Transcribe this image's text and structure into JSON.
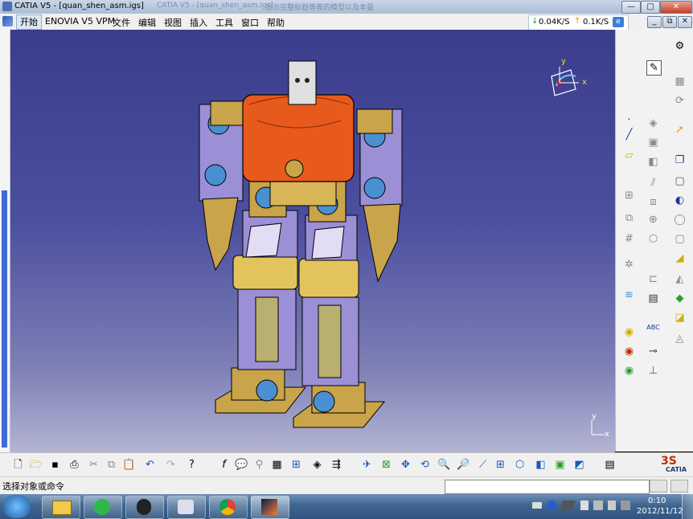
{
  "window": {
    "title": "CATIA V5 - [quan_shen_asm.igs]",
    "faded_title_1": "CATIA V5 - [quan_shen_asm.igs]",
    "faded_title_2": "显示完整标题等等的模型以及本量",
    "buttons": [
      "—",
      "□",
      "✕"
    ],
    "mdi_buttons": [
      "_",
      "⧉",
      "✕"
    ]
  },
  "menubar": {
    "items": [
      "开始",
      "ENOVIA V5 VPM",
      "文件",
      "编辑",
      "视图",
      "插入",
      "工具",
      "窗口",
      "帮助"
    ]
  },
  "network": {
    "down": "0.04K/S",
    "up": "0.1K/S"
  },
  "compass": {
    "x_label": "x",
    "y_label": "y"
  },
  "corner_axis": {
    "x_label": "x",
    "y_label": "y"
  },
  "statusbar": {
    "prompt": "选择对象或命令",
    "command_value": ""
  },
  "brand": {
    "logo_text": "CATIA"
  },
  "taskbar": {
    "time": "0:10",
    "date": "2012/11/12"
  },
  "icons": {
    "right_toolbar": [
      "gear-icon",
      "sketch-icon",
      "measure-icon",
      "arrow-select-icon",
      "point-icon",
      "line-icon",
      "plane-icon",
      "axis-icon",
      "product-icon",
      "component-icon",
      "new-part-icon",
      "existing-component-icon",
      "replace-icon",
      "manipulate-icon",
      "snap-icon",
      "explode-icon",
      "constraint-icon",
      "offset-icon",
      "angle-icon",
      "fix-icon",
      "update-icon",
      "catalog-icon",
      "scene-icon",
      "annotation-icon",
      "text-icon",
      "flag-icon",
      "weld-icon",
      "clash-icon",
      "section-icon",
      "distance-icon"
    ],
    "bottom_toolbar": [
      "new-icon",
      "open-icon",
      "save-icon",
      "print-icon",
      "cut-icon",
      "copy-icon",
      "paste-icon",
      "undo-icon",
      "redo-icon",
      "whats-this-icon",
      "formula-icon",
      "comment-icon",
      "tools-icon",
      "grid-icon",
      "tree-icon",
      "hide-icon",
      "swap-icon",
      "fly-icon",
      "fit-all-icon",
      "pan-icon",
      "rotate-icon",
      "zoom-in-icon",
      "zoom-out-icon",
      "normal-view-icon",
      "multi-view-icon",
      "iso-view-icon",
      "shading-icon",
      "hide-show-icon",
      "swap-space-icon",
      "properties-icon"
    ]
  },
  "colors": {
    "viewport_top": "#3a3d8c",
    "viewport_bottom": "#b4b4d4",
    "torso": "#e8591c",
    "bracket": "#c9a44a",
    "servo": "#9b8fd6",
    "servo_horn": "#4a8fd1"
  }
}
